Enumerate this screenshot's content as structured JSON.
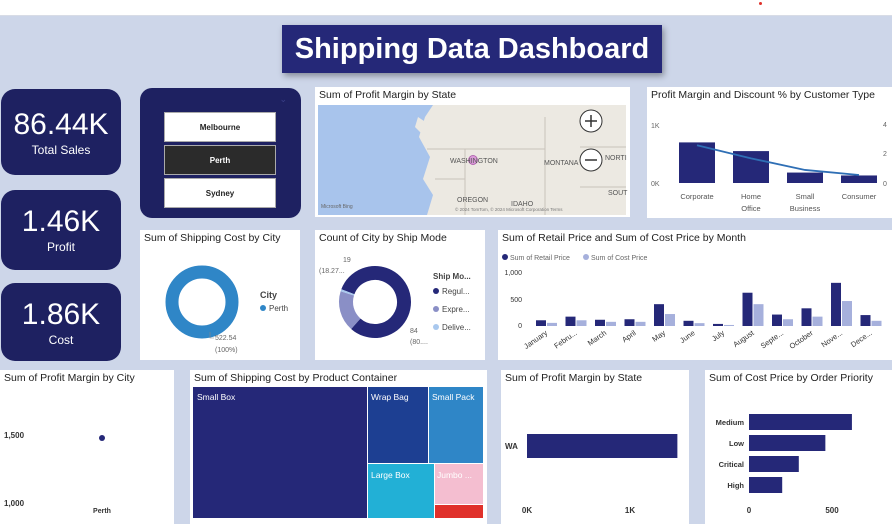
{
  "header": {
    "title": "Shipping Data Dashboard"
  },
  "kpis": [
    {
      "value": "86.44K",
      "label": "Total Sales"
    },
    {
      "value": "1.46K",
      "label": "Profit"
    },
    {
      "value": "1.86K",
      "label": "Cost"
    }
  ],
  "slicer": {
    "items": [
      "Melbourne",
      "Perth",
      "Sydney"
    ],
    "selected": "Perth"
  },
  "map": {
    "title": "Sum of Profit Margin by State",
    "labels": [
      "WASHINGTON",
      "MONTANA",
      "OREGON",
      "IDAHO",
      "NORTI",
      "SOUT"
    ],
    "attribution": "© 2024 TomTom, © 2024 Microsoft Corporation Terms",
    "brand": "Microsoft Bing"
  },
  "pm_customer": {
    "title": "Profit Margin and Discount % by Customer Type",
    "left_axis": [
      "1K",
      "0K"
    ],
    "right_axis": [
      "4",
      "2",
      "0"
    ],
    "chart_data": {
      "type": "bar",
      "categories": [
        "Corporate",
        "Home Office",
        "Small Business",
        "Consumer"
      ],
      "series": [
        {
          "name": "Profit Margin",
          "values": [
            700,
            550,
            180,
            130
          ]
        },
        {
          "name": "Discount %",
          "values": [
            2.6,
            1.7,
            0.9,
            0.55
          ]
        }
      ]
    }
  },
  "ship_city": {
    "title": "Sum of Shipping Cost by City",
    "legend_title": "City",
    "legend_item": "Perth",
    "value_label": "522.54",
    "pct_label": "(100%)",
    "chart_data": {
      "type": "pie",
      "categories": [
        "Perth"
      ],
      "values": [
        522.54
      ]
    }
  },
  "ship_mode": {
    "title": "Count of City by Ship Mode",
    "legend_title": "Ship Mo...",
    "legend_items": [
      "Regul...",
      "Expre...",
      "Delive..."
    ],
    "small_label": "19",
    "small_pct": "(18.27...",
    "big_label": "84",
    "big_pct": "(80....",
    "colors": [
      "#252878",
      "#8a8fc6",
      "#a9c8ee"
    ],
    "chart_data": {
      "type": "pie",
      "categories": [
        "Regul...",
        "Expre...",
        "Delive..."
      ],
      "values": [
        84,
        19,
        1
      ]
    }
  },
  "retail": {
    "title": "Sum of Retail Price and Sum of Cost Price by Month",
    "legend": [
      "Sum of Retail Price",
      "Sum of Cost Price"
    ],
    "y_ticks": [
      "1,000",
      "500",
      "0"
    ],
    "chart_data": {
      "type": "bar",
      "categories": [
        "January",
        "Febru...",
        "March",
        "April",
        "May",
        "June",
        "July",
        "August",
        "Septe...",
        "October",
        "Nove...",
        "Dece..."
      ],
      "series": [
        {
          "name": "Sum of Retail Price",
          "values": [
            110,
            180,
            120,
            130,
            420,
            100,
            40,
            640,
            220,
            340,
            830,
            210
          ]
        },
        {
          "name": "Sum of Cost Price",
          "values": [
            60,
            110,
            80,
            80,
            230,
            55,
            20,
            420,
            130,
            180,
            480,
            100
          ]
        }
      ],
      "ylim": [
        0,
        1000
      ]
    }
  },
  "pm_city": {
    "title": "Sum of Profit Margin by City",
    "y_ticks": [
      "1,500",
      "1,000"
    ],
    "chart_data": {
      "type": "scatter",
      "x": [
        "Perth"
      ],
      "y": [
        1460
      ],
      "ylim": [
        1000,
        1500
      ]
    }
  },
  "container": {
    "title": "Sum of Shipping Cost by Product Container",
    "labels": [
      "Small Box",
      "Wrap Bag",
      "Small Pack",
      "Large Box",
      "Jumbo ..."
    ],
    "chart_data": {
      "type": "heatmap",
      "categories": [
        "Small Box",
        "Wrap Bag",
        "Small Pack",
        "Large Box",
        "Jumbo ..."
      ],
      "values": [
        240,
        60,
        55,
        55,
        40
      ]
    }
  },
  "pm_state": {
    "title": "Sum of Profit Margin by State",
    "x_ticks": [
      "0K",
      "1K"
    ],
    "chart_data": {
      "type": "bar",
      "categories": [
        "WA"
      ],
      "values": [
        1460
      ],
      "xlim": [
        0,
        1500
      ]
    }
  },
  "cost_priority": {
    "title": "Sum of Cost Price by Order Priority",
    "x_ticks": [
      "0",
      "500"
    ],
    "chart_data": {
      "type": "bar",
      "categories": [
        "Medium",
        "Low",
        "Critical",
        "High"
      ],
      "values": [
        620,
        460,
        300,
        200
      ],
      "xlim": [
        0,
        700
      ]
    }
  }
}
